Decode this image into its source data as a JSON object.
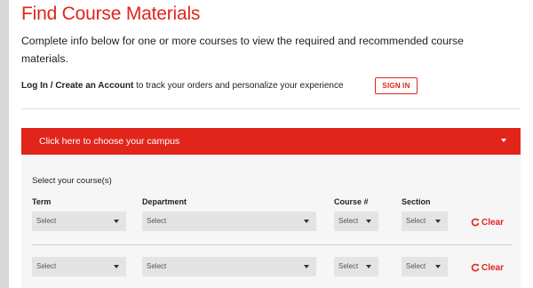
{
  "header": {
    "title": "Find Course Materials",
    "intro": "Complete info below for one or more courses to view the required and recommended course materials."
  },
  "login": {
    "link_text": "Log In / Create an Account",
    "rest_text": " to track your orders and personalize your experience",
    "signin_label": "SIGN IN"
  },
  "campus": {
    "label": "Click here to choose your campus",
    "caret_icon": "caret-down-icon"
  },
  "course": {
    "heading": "Select your course(s)",
    "columns": {
      "term": "Term",
      "department": "Department",
      "course": "Course #",
      "section": "Section"
    },
    "rows": [
      {
        "term": "Select",
        "department": "Select",
        "course": "Select",
        "section": "Select",
        "clear": "Clear"
      },
      {
        "term": "Select",
        "department": "Select",
        "course": "Select",
        "section": "Select",
        "clear": "Clear"
      }
    ]
  },
  "colors": {
    "accent": "#e1251b",
    "select_bg": "#e4e4e4",
    "course_area_bg": "#f6f6f6"
  }
}
